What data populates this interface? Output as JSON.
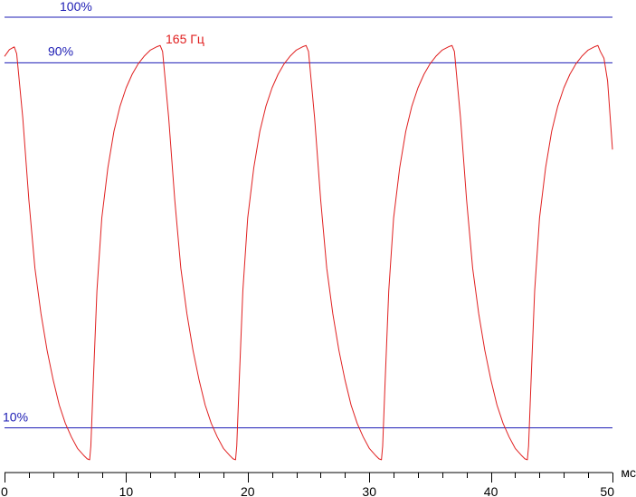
{
  "chart_data": {
    "type": "line",
    "title": "",
    "xlabel": "мс",
    "ylabel": "",
    "xlim": [
      0,
      50
    ],
    "ylim": [
      0,
      100
    ],
    "grid": false,
    "x_ticks": [
      0,
      10,
      20,
      30,
      40,
      50
    ],
    "x_tick_labels": [
      "0",
      "10",
      "20",
      "30",
      "40",
      "50"
    ],
    "reference_lines": [
      {
        "label": "100%",
        "value": 100,
        "color": "#1c1cb4"
      },
      {
        "label": "90%",
        "value": 90,
        "color": "#1c1cb4"
      },
      {
        "label": "10%",
        "value": 10,
        "color": "#1c1cb4"
      }
    ],
    "series": [
      {
        "name": "165 Гц",
        "color": "#e02020",
        "x": [
          0,
          0.4,
          0.8,
          1.0,
          1.5,
          2.0,
          2.5,
          3.0,
          3.5,
          4.0,
          4.5,
          5.0,
          5.5,
          6.0,
          6.5,
          6.8,
          7.0,
          7.1,
          7.3,
          7.6,
          8.0,
          8.5,
          9.0,
          9.5,
          10.0,
          10.5,
          11.0,
          11.5,
          12.0,
          12.5,
          12.8,
          13.0,
          13.5,
          14.0,
          14.5,
          15.0,
          15.5,
          16.0,
          16.5,
          17.0,
          17.5,
          18.0,
          18.5,
          18.8,
          19.0,
          19.1,
          19.3,
          19.6,
          20.0,
          20.5,
          21.0,
          21.5,
          22.0,
          22.5,
          23.0,
          23.5,
          24.0,
          24.5,
          24.8,
          25.0,
          25.5,
          26.0,
          26.5,
          27.0,
          27.5,
          28.0,
          28.5,
          29.0,
          29.5,
          30.0,
          30.5,
          30.8,
          31.0,
          31.1,
          31.3,
          31.6,
          32.0,
          32.5,
          33.0,
          33.5,
          34.0,
          34.5,
          35.0,
          35.5,
          36.0,
          36.5,
          36.8,
          37.0,
          37.5,
          38.0,
          38.5,
          39.0,
          39.5,
          40.0,
          40.5,
          41.0,
          41.5,
          42.0,
          42.5,
          42.8,
          43.0,
          43.1,
          43.3,
          43.6,
          44.0,
          44.5,
          45.0,
          45.5,
          46.0,
          46.5,
          47.0,
          47.5,
          48.0,
          48.5,
          48.8,
          49.0,
          49.3,
          49.6,
          50.0
        ],
        "y": [
          91.4,
          92.9,
          93.5,
          92.0,
          78.0,
          60.0,
          45.0,
          35.0,
          27.0,
          20.5,
          15.0,
          11.0,
          8.0,
          5.5,
          4.0,
          3.2,
          3.0,
          6.0,
          20.0,
          40.0,
          56.0,
          67.0,
          75.0,
          80.5,
          84.5,
          87.5,
          89.8,
          91.5,
          92.8,
          93.5,
          93.8,
          92.5,
          78.0,
          60.0,
          45.0,
          35.0,
          27.0,
          20.5,
          15.0,
          11.0,
          8.0,
          5.5,
          4.0,
          3.2,
          3.0,
          6.0,
          20.0,
          40.0,
          56.0,
          67.0,
          75.0,
          80.5,
          84.5,
          87.5,
          89.8,
          91.5,
          92.8,
          93.5,
          93.8,
          92.5,
          78.0,
          60.0,
          45.0,
          35.0,
          27.0,
          20.5,
          15.0,
          11.0,
          8.0,
          5.5,
          4.0,
          3.2,
          3.0,
          6.0,
          20.0,
          40.0,
          56.0,
          67.0,
          75.0,
          80.5,
          84.5,
          87.5,
          89.8,
          91.5,
          92.8,
          93.5,
          93.8,
          92.5,
          78.0,
          60.0,
          45.0,
          35.0,
          27.0,
          20.5,
          15.0,
          11.0,
          8.0,
          5.5,
          4.0,
          3.2,
          3.0,
          6.0,
          20.0,
          40.0,
          56.0,
          67.0,
          75.0,
          80.5,
          84.5,
          87.5,
          89.8,
          91.5,
          92.8,
          93.5,
          93.8,
          92.5,
          91.0,
          86.0,
          71.0
        ]
      }
    ]
  }
}
